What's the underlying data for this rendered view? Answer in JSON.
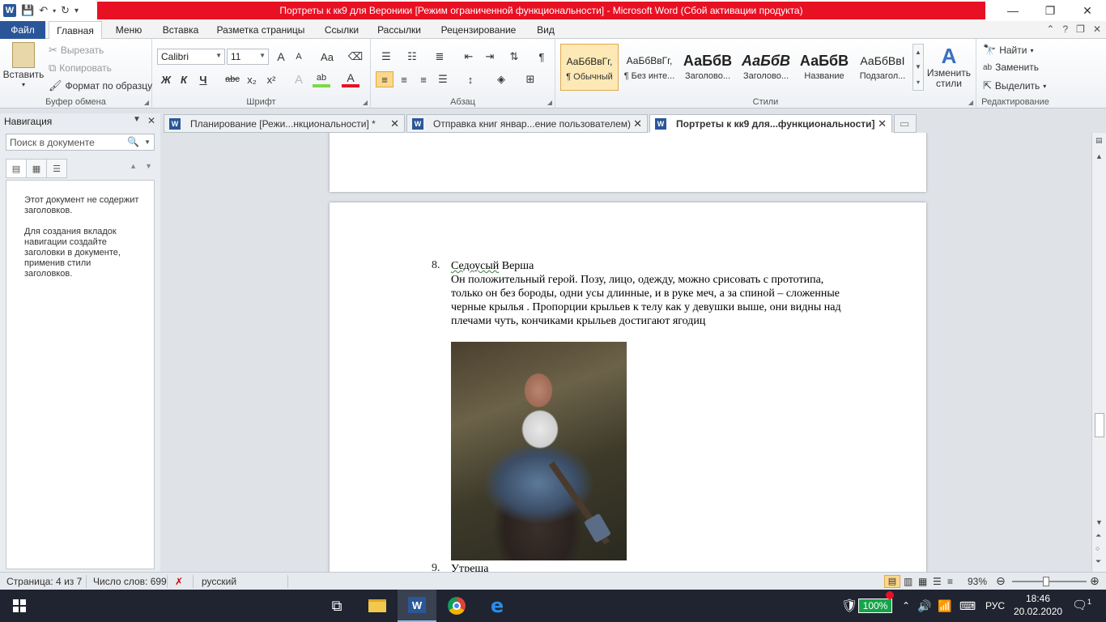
{
  "titlebar": {
    "title": "Портреты к кк9 для Вероники [Режим ограниченной функциональности]  -  Microsoft Word (Сбой активации продукта)",
    "app_icon": "W"
  },
  "ribbon_tabs": [
    {
      "label": "Файл"
    },
    {
      "label": "Главная"
    },
    {
      "label": "Меню"
    },
    {
      "label": "Вставка"
    },
    {
      "label": "Разметка страницы"
    },
    {
      "label": "Ссылки"
    },
    {
      "label": "Рассылки"
    },
    {
      "label": "Рецензирование"
    },
    {
      "label": "Вид"
    }
  ],
  "clipboard": {
    "paste": "Вставить",
    "cut": "Вырезать",
    "copy": "Копировать",
    "format_painter": "Формат по образцу",
    "group": "Буфер обмена"
  },
  "font": {
    "name": "Calibri",
    "size": "11",
    "group": "Шрифт",
    "bold": "Ж",
    "italic": "К",
    "underline": "Ч",
    "strike": "abc",
    "sub": "x₂",
    "sup": "x²",
    "grow": "A",
    "shrink": "A",
    "case": "Aa",
    "color_a": "A",
    "highlight": "ab"
  },
  "paragraph": {
    "group": "Абзац"
  },
  "styles": {
    "group": "Стили",
    "items": [
      {
        "sample": "АаБбВвГг,",
        "name": "¶ Обычный"
      },
      {
        "sample": "АаБбВвГг,",
        "name": "¶ Без инте..."
      },
      {
        "sample": "АаБбВ",
        "name": "Заголово..."
      },
      {
        "sample": "АаБбВ",
        "name": "Заголово..."
      },
      {
        "sample": "АаБбВ",
        "name": "Название"
      },
      {
        "sample": "АаБбВвI",
        "name": "Подзагол..."
      }
    ],
    "change": "Изменить стили"
  },
  "editing": {
    "group": "Редактирование",
    "find": "Найти",
    "replace": "Заменить",
    "select": "Выделить"
  },
  "navigation": {
    "title": "Навигация",
    "search_placeholder": "Поиск в документе",
    "message1": "Этот документ не содержит заголовков.",
    "message2": "Для создания вкладок навигации создайте заголовки в документе, применив стили заголовков."
  },
  "doc_tabs": [
    {
      "label": "Планирование [Режи...нкциональности]  *"
    },
    {
      "label": "Отправка книг январ...ение пользователем)"
    },
    {
      "label": "Портреты к кк9 для...функциональности]"
    }
  ],
  "document": {
    "item8_number": "8.",
    "item8_title_a": "Седоусый",
    "item8_title_b": " Верша",
    "item8_line1": "Он положительный герой. Позу, лицо, одежду, можно срисовать с прототипа,",
    "item8_line2": "только он без бороды, одни усы длинные, и в руке меч, а за спиной – сложенные",
    "item8_line3a": "черные крылья",
    "item8_line3b": " . Пропорции крыльев к телу как у девушки выше, они видны над",
    "item8_line4": "плечами чуть, кончиками крыльев достигают ягодиц",
    "item9_number": "9.",
    "item9_title": "Утреша"
  },
  "statusbar": {
    "page": "Страница: 4 из 7",
    "words": "Число слов: 699",
    "language": "русский",
    "zoom": "93%"
  },
  "taskbar": {
    "battery": "100%",
    "lang": "РУС",
    "time": "18:46",
    "date": "20.02.2020",
    "notifications": "1"
  }
}
